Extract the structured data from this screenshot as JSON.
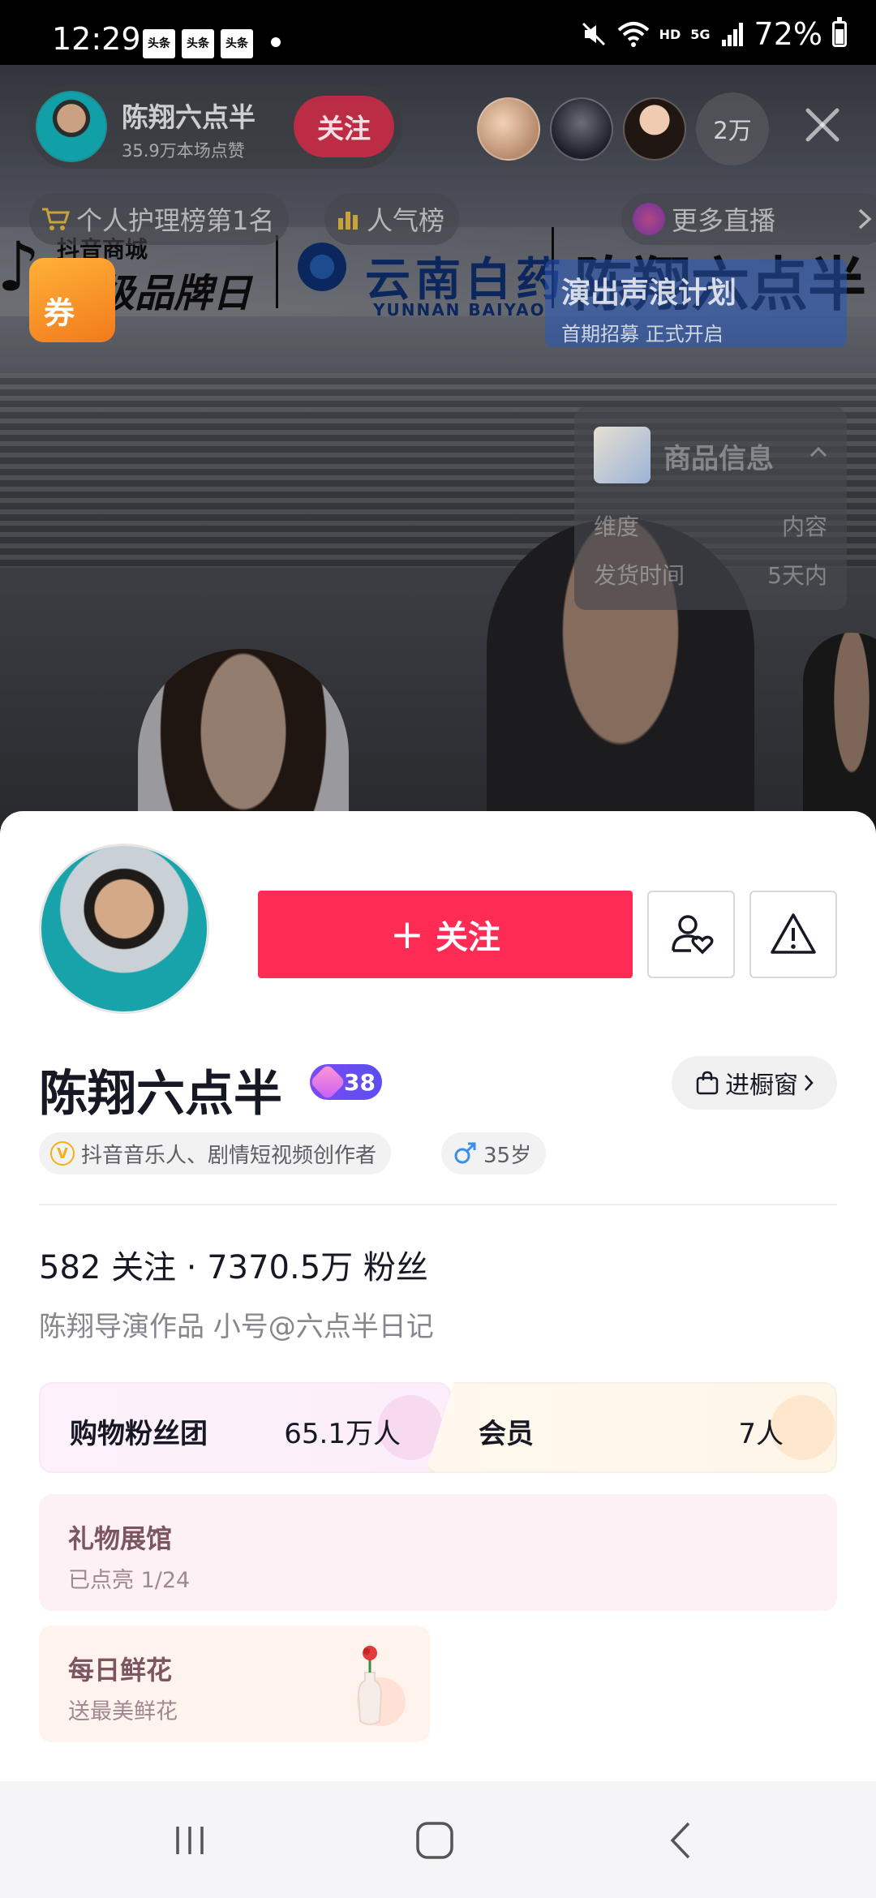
{
  "status_bar": {
    "time": "12:29",
    "notif_label": "头条",
    "network": "HD",
    "signal": "5G",
    "battery": "72%"
  },
  "live": {
    "host_name": "陈翔六点半",
    "host_likes": "35.9万本场点赞",
    "follow_label": "关注",
    "viewer_count": "2万",
    "rank_chip": "个人护理榜第1名",
    "popularity_chip": "人气榜",
    "more_live_chip": "更多直播",
    "banner": {
      "mall": "抖音商城",
      "day": "超级品牌日",
      "yunnan_cn": "云南白药",
      "yunnan_en": "YUNNAN BAIYAO",
      "name": "陈翔六点半"
    },
    "coupon_label": "券",
    "campaign_title": "演出声浪计划",
    "campaign_sub": "首期招募 正式开启",
    "product_panel": {
      "title": "商品信息",
      "rows": [
        {
          "label": "维度",
          "value": "内容"
        },
        {
          "label": "发货时间",
          "value": "5天内"
        }
      ]
    }
  },
  "profile": {
    "follow_button": "关注",
    "name": "陈翔六点半",
    "fan_level": "38",
    "window_button": "进橱窗",
    "creator_tag": "抖音音乐人、剧情短视频创作者",
    "gender_age": "35岁",
    "stats": "582 关注 · 7370.5万 粉丝",
    "bio": "陈翔导演作品 小号@六点半日记",
    "fan_club_label": "购物粉丝团",
    "fan_club_value": "65.1万人",
    "member_label": "会员",
    "member_value": "7人",
    "gift_title": "礼物展馆",
    "gift_sub": "已点亮 1/24",
    "flower_title": "每日鲜花",
    "flower_sub": "送最美鲜花"
  },
  "colors": {
    "accent": "#fe2c55",
    "fan_level": "#6a4df0"
  }
}
